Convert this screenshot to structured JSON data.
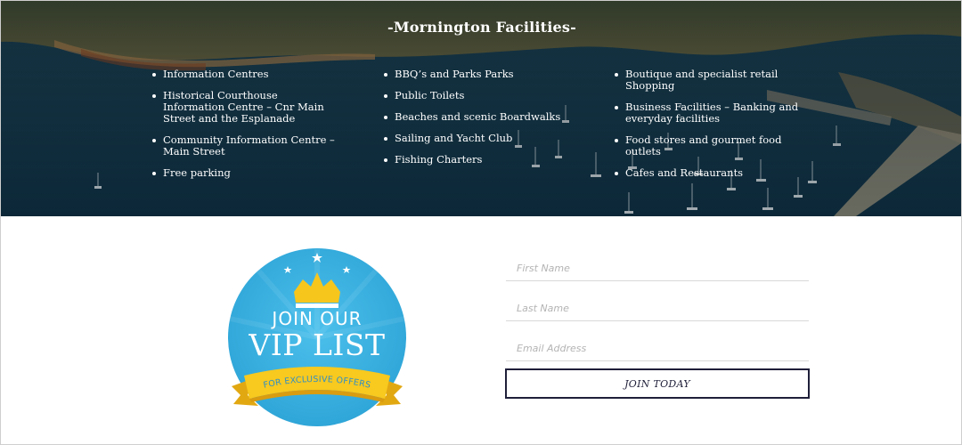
{
  "hero": {
    "title": "-Mornington Facilities-",
    "columns": [
      [
        "Information Centres",
        "Historical Courthouse Information Centre – Cnr Main Street and the Esplanade",
        "Community Information Centre – Main Street",
        "Free parking"
      ],
      [
        "BBQ’s and Parks Parks",
        "Public Toilets",
        "Beaches and scenic Boardwalks",
        "Sailing and Yacht Club",
        "Fishing Charters"
      ],
      [
        "Boutique and specialist retail Shopping",
        "Business Facilities – Banking and everyday facilities",
        "Food stores and gourmet food outlets",
        "Cafes and Restaurants"
      ]
    ]
  },
  "badge": {
    "line1": "JOIN OUR",
    "line2": "VIP LIST",
    "ribbon": "FOR EXCLUSIVE OFFERS"
  },
  "form": {
    "first_name_placeholder": "First Name",
    "last_name_placeholder": "Last Name",
    "email_placeholder": "Email Address",
    "submit_label": "JOIN TODAY"
  },
  "colors": {
    "hero_water": "#123a52",
    "badge_blue": "#3eb2e2",
    "crown_yellow": "#f6c61d",
    "button_border": "#1f1f3a"
  }
}
